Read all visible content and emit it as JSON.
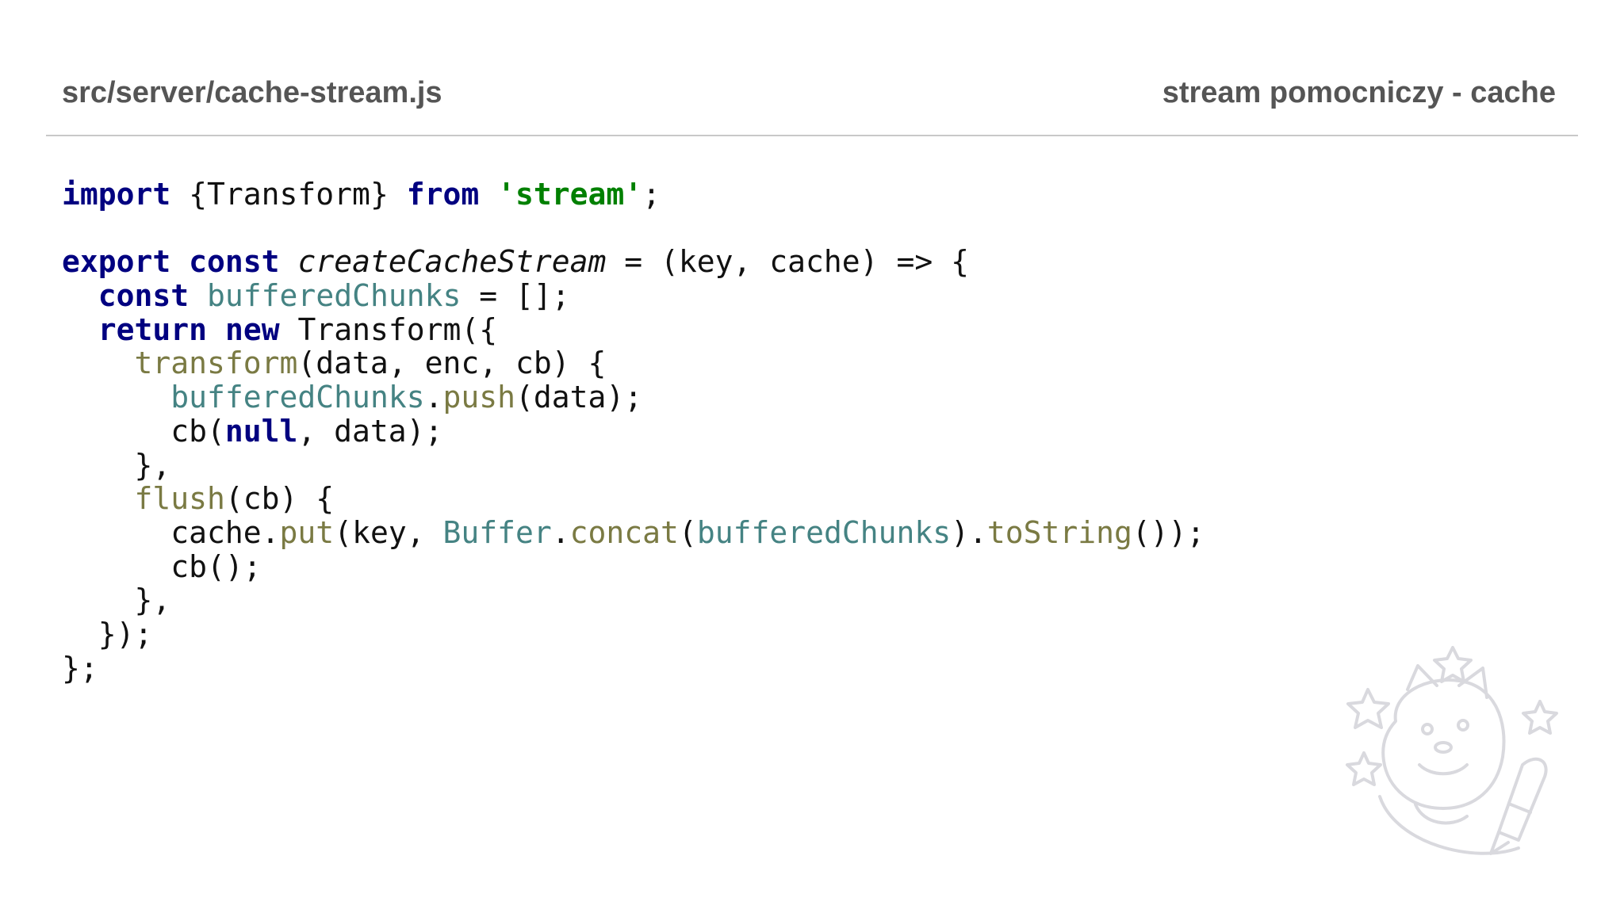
{
  "header": {
    "file_path": "src/server/cache-stream.js",
    "slide_title": "stream pomocniczy - cache"
  },
  "colors": {
    "keyword": "#000080",
    "string": "#008000",
    "variable": "#458383",
    "method": "#7a7a43",
    "plain": "#111111",
    "header_text": "#555555",
    "divider": "#c8c8c8"
  },
  "code": {
    "language": "javascript",
    "lines": [
      [
        {
          "t": "kw",
          "v": "import"
        },
        {
          "t": "plain",
          "v": " {Transform} "
        },
        {
          "t": "kw",
          "v": "from"
        },
        {
          "t": "plain",
          "v": " "
        },
        {
          "t": "str",
          "v": "'stream'"
        },
        {
          "t": "plain",
          "v": ";"
        }
      ],
      [],
      [
        {
          "t": "kw",
          "v": "export"
        },
        {
          "t": "plain",
          "v": " "
        },
        {
          "t": "kw",
          "v": "const"
        },
        {
          "t": "plain",
          "v": " "
        },
        {
          "t": "fn",
          "v": "createCacheStream"
        },
        {
          "t": "plain",
          "v": " = (key, cache) => {"
        }
      ],
      [
        {
          "t": "plain",
          "v": "  "
        },
        {
          "t": "kw",
          "v": "const"
        },
        {
          "t": "plain",
          "v": " "
        },
        {
          "t": "var",
          "v": "bufferedChunks"
        },
        {
          "t": "plain",
          "v": " = [];"
        }
      ],
      [
        {
          "t": "plain",
          "v": "  "
        },
        {
          "t": "kw",
          "v": "return"
        },
        {
          "t": "plain",
          "v": " "
        },
        {
          "t": "kw",
          "v": "new"
        },
        {
          "t": "plain",
          "v": " Transform({"
        }
      ],
      [
        {
          "t": "plain",
          "v": "    "
        },
        {
          "t": "method",
          "v": "transform"
        },
        {
          "t": "plain",
          "v": "(data, enc, cb) {"
        }
      ],
      [
        {
          "t": "plain",
          "v": "      "
        },
        {
          "t": "var",
          "v": "bufferedChunks"
        },
        {
          "t": "plain",
          "v": "."
        },
        {
          "t": "method",
          "v": "push"
        },
        {
          "t": "plain",
          "v": "(data);"
        }
      ],
      [
        {
          "t": "plain",
          "v": "      cb("
        },
        {
          "t": "kw",
          "v": "null"
        },
        {
          "t": "plain",
          "v": ", data);"
        }
      ],
      [
        {
          "t": "plain",
          "v": "    },"
        }
      ],
      [
        {
          "t": "plain",
          "v": "    "
        },
        {
          "t": "method",
          "v": "flush"
        },
        {
          "t": "plain",
          "v": "(cb) {"
        }
      ],
      [
        {
          "t": "plain",
          "v": "      cache."
        },
        {
          "t": "method",
          "v": "put"
        },
        {
          "t": "plain",
          "v": "(key, "
        },
        {
          "t": "var",
          "v": "Buffer"
        },
        {
          "t": "plain",
          "v": "."
        },
        {
          "t": "method",
          "v": "concat"
        },
        {
          "t": "plain",
          "v": "("
        },
        {
          "t": "var",
          "v": "bufferedChunks"
        },
        {
          "t": "plain",
          "v": ")."
        },
        {
          "t": "method",
          "v": "toString"
        },
        {
          "t": "plain",
          "v": "());"
        }
      ],
      [
        {
          "t": "plain",
          "v": "      cb();"
        }
      ],
      [
        {
          "t": "plain",
          "v": "    },"
        }
      ],
      [
        {
          "t": "plain",
          "v": "  });"
        }
      ],
      [
        {
          "t": "plain",
          "v": "};"
        }
      ]
    ]
  },
  "decorations": {
    "mascot_icon": "doge-astronaut-icon"
  }
}
